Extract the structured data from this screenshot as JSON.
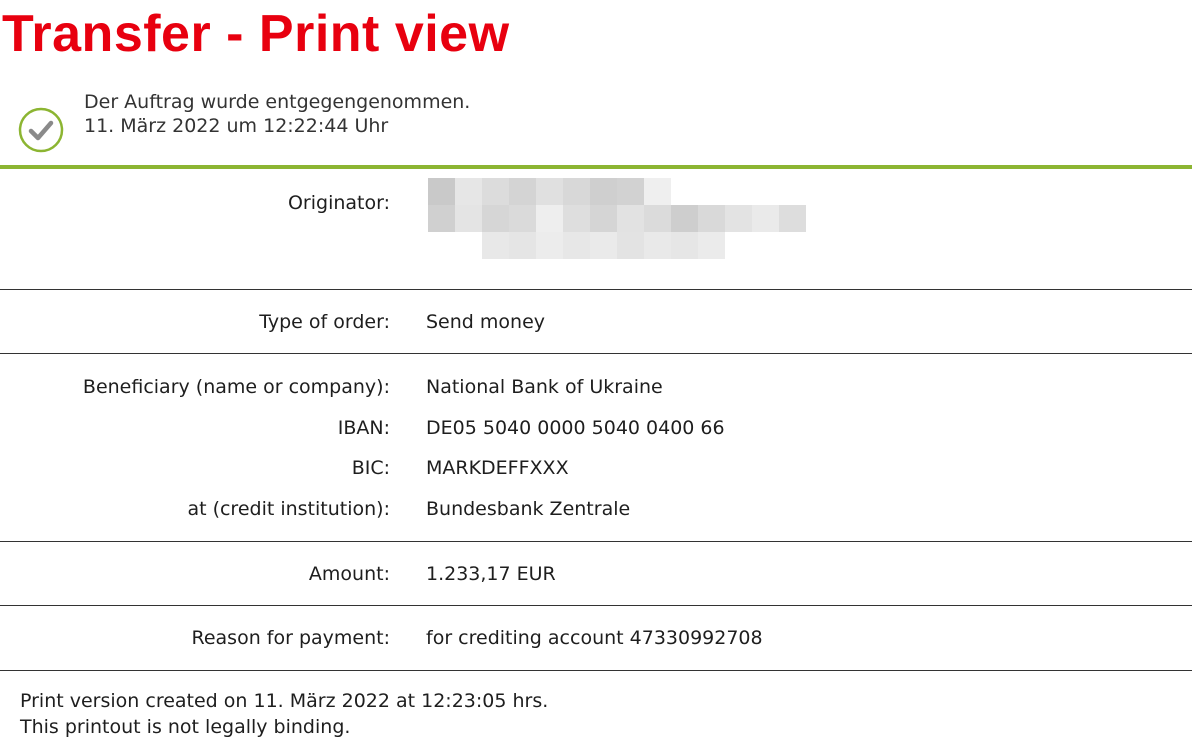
{
  "page": {
    "title": "Transfer - Print view"
  },
  "status": {
    "icon": "checkmark-circle-icon",
    "line1": "Der Auftrag wurde entgegengenommen.",
    "line2": "11. März 2022 um 12:22:44 Uhr",
    "accent_color": "#8cb532"
  },
  "details": {
    "originator_label": "Originator:",
    "originator_value_state": "redacted",
    "order_type_label": "Type of order:",
    "order_type_value": "Send money",
    "beneficiary_label": "Beneficiary (name or company):",
    "beneficiary_value": "National Bank of Ukraine",
    "iban_label": "IBAN:",
    "iban_value": "DE05 5040 0000 5040 0400 66",
    "bic_label": "BIC:",
    "bic_value": "MARKDEFFXXX",
    "institution_label": "at (credit institution):",
    "institution_value": "Bundesbank Zentrale",
    "amount_label": "Amount:",
    "amount_value": "1.233,17 EUR",
    "reason_label": "Reason for payment:",
    "reason_value": "for crediting account 47330992708"
  },
  "footer": {
    "created": "Print version created on 11. März 2022 at 12:23:05 hrs.",
    "second_line_partial": "This printout is not legally binding."
  },
  "colors": {
    "title": "#e8000f",
    "rule": "#8cb532"
  }
}
